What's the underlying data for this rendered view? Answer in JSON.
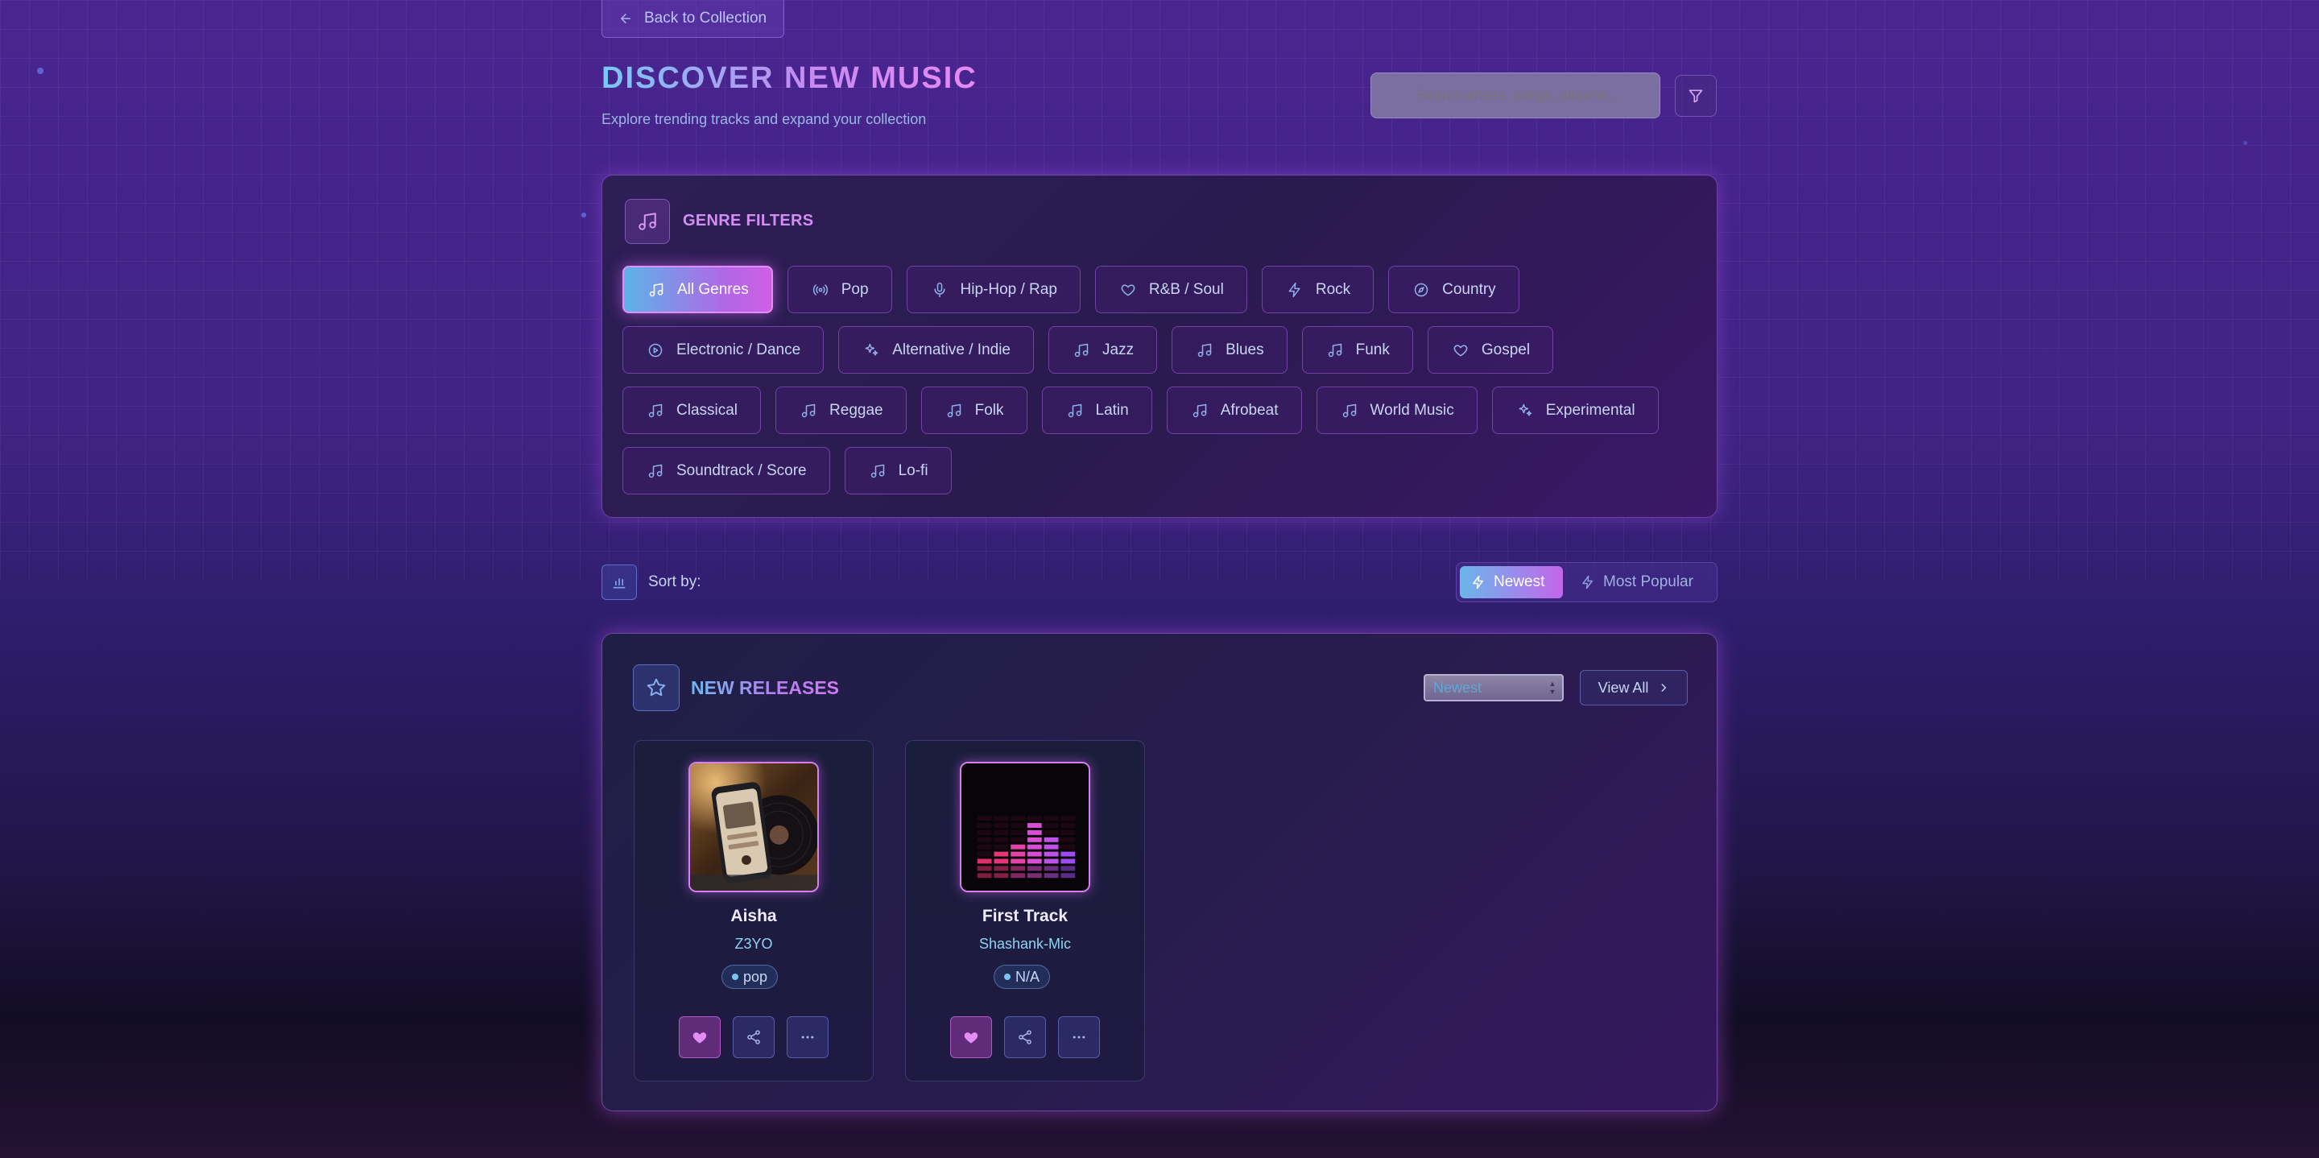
{
  "nav": {
    "back_label": "Back to Collection"
  },
  "header": {
    "title": "DISCOVER NEW MUSIC",
    "subtitle": "Explore trending tracks and expand your collection"
  },
  "search": {
    "placeholder": "Search artists, songs, albums..."
  },
  "genre_panel": {
    "title": "GENRE FILTERS",
    "genres": [
      {
        "label": "All Genres",
        "icon": "music-note-icon",
        "active": true
      },
      {
        "label": "Pop",
        "icon": "broadcast-icon",
        "active": false
      },
      {
        "label": "Hip-Hop / Rap",
        "icon": "microphone-icon",
        "active": false
      },
      {
        "label": "R&B / Soul",
        "icon": "heart-icon",
        "active": false
      },
      {
        "label": "Rock",
        "icon": "lightning-icon",
        "active": false
      },
      {
        "label": "Country",
        "icon": "compass-icon",
        "active": false
      },
      {
        "label": "Electronic / Dance",
        "icon": "play-circle-icon",
        "active": false
      },
      {
        "label": "Alternative / Indie",
        "icon": "sparkles-icon",
        "active": false
      },
      {
        "label": "Jazz",
        "icon": "music-note-icon",
        "active": false
      },
      {
        "label": "Blues",
        "icon": "music-note-icon",
        "active": false
      },
      {
        "label": "Funk",
        "icon": "music-note-icon",
        "active": false
      },
      {
        "label": "Gospel",
        "icon": "heart-icon",
        "active": false
      },
      {
        "label": "Classical",
        "icon": "music-note-icon",
        "active": false
      },
      {
        "label": "Reggae",
        "icon": "music-note-icon",
        "active": false
      },
      {
        "label": "Folk",
        "icon": "music-note-icon",
        "active": false
      },
      {
        "label": "Latin",
        "icon": "music-note-icon",
        "active": false
      },
      {
        "label": "Afrobeat",
        "icon": "music-note-icon",
        "active": false
      },
      {
        "label": "World Music",
        "icon": "music-note-icon",
        "active": false
      },
      {
        "label": "Experimental",
        "icon": "sparkles-icon",
        "active": false
      },
      {
        "label": "Soundtrack / Score",
        "icon": "music-note-icon",
        "active": false
      },
      {
        "label": "Lo-fi",
        "icon": "music-note-icon",
        "active": false
      }
    ]
  },
  "sort": {
    "label": "Sort by:",
    "options": [
      {
        "label": "Newest",
        "icon": "lightning-icon",
        "active": true
      },
      {
        "label": "Most Popular",
        "icon": "lightning-icon",
        "active": false
      }
    ]
  },
  "releases": {
    "title": "NEW RELEASES",
    "select_value": "Newest",
    "view_all_label": "View All",
    "cards": [
      {
        "title": "Aisha",
        "artist": "Z3YO",
        "genre": "pop",
        "cover": "phone-and-vinyl-photo"
      },
      {
        "title": "First Track",
        "artist": "Shashank-Mic",
        "genre": "N/A",
        "cover": "equalizer-bars-art"
      }
    ]
  },
  "colors": {
    "accent_blue": "#6bb6ea",
    "accent_pink": "#cf5fe6",
    "panel_border": "#b46eff",
    "text_primary": "#c8d6f6"
  }
}
